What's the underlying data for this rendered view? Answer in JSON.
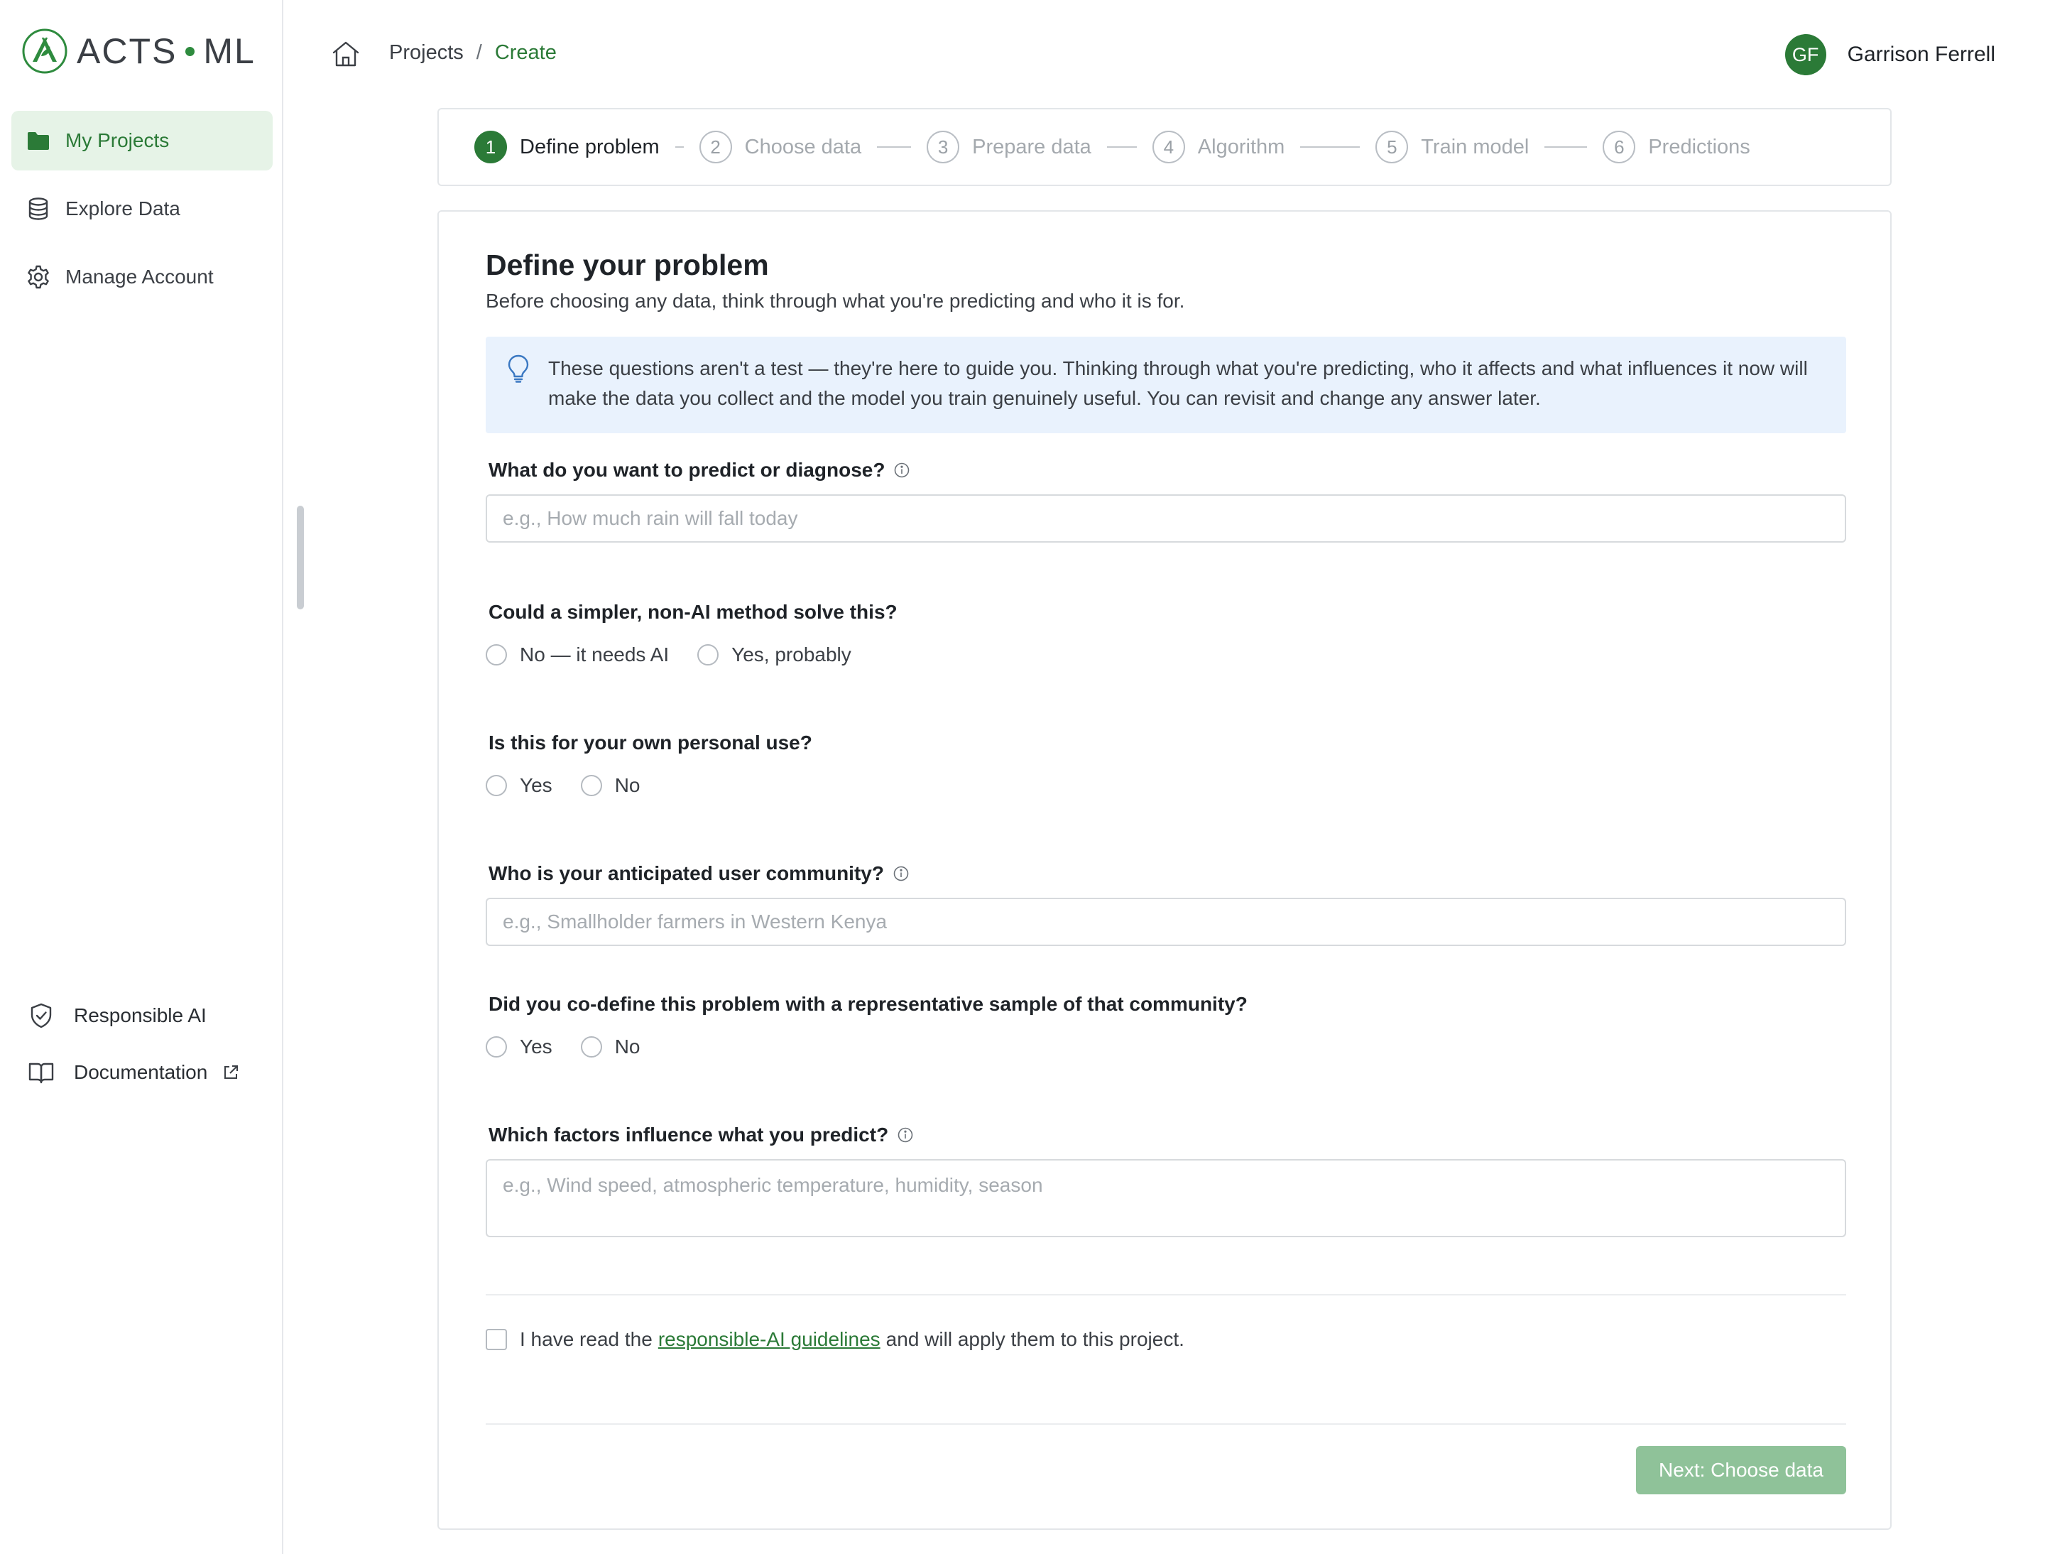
{
  "app": {
    "logo_left": "ACTS",
    "logo_right": "ML"
  },
  "sidebar": {
    "items": [
      {
        "label": "My Projects",
        "icon": "folder-icon",
        "active": true
      },
      {
        "label": "Explore Data",
        "icon": "database-icon",
        "active": false
      },
      {
        "label": "Manage Account",
        "icon": "gear-icon",
        "active": false
      }
    ],
    "bottom": [
      {
        "label": "Responsible AI",
        "icon": "shield-check-icon"
      },
      {
        "label": "Documentation",
        "icon": "book-icon",
        "external": true
      }
    ]
  },
  "header": {
    "breadcrumb": {
      "projects": "Projects",
      "separator": "/",
      "current": "Create"
    },
    "user": {
      "initials": "GF",
      "name": "Garrison Ferrell"
    }
  },
  "stepper": {
    "steps": [
      {
        "num": "1",
        "label": "Define problem",
        "active": true
      },
      {
        "num": "2",
        "label": "Choose data",
        "active": false
      },
      {
        "num": "3",
        "label": "Prepare data",
        "active": false
      },
      {
        "num": "4",
        "label": "Algorithm",
        "active": false
      },
      {
        "num": "5",
        "label": "Train model",
        "active": false
      },
      {
        "num": "6",
        "label": "Predictions",
        "active": false
      }
    ]
  },
  "form": {
    "title": "Define your problem",
    "subtitle": "Before choosing any data, think through what you're predicting and who it is for.",
    "info": "These questions aren't a test — they're here to guide you. Thinking through what you're predicting, who it affects and what influences it now will make the data you collect and the model you train genuinely useful. You can revisit and change any answer later.",
    "q1": {
      "label": "What do you want to predict or diagnose?",
      "placeholder": "e.g., How much rain will fall today",
      "value": ""
    },
    "q2": {
      "label": "Could a simpler, non-AI method solve this?",
      "options": [
        "No — it needs AI",
        "Yes, probably"
      ],
      "selected": null
    },
    "q3": {
      "label": "Is this for your own personal use?",
      "options": [
        "Yes",
        "No"
      ],
      "selected": null
    },
    "q4": {
      "label": "Who is your anticipated user community?",
      "placeholder": "e.g., Smallholder farmers in Western Kenya",
      "value": ""
    },
    "q5": {
      "label": "Did you co-define this problem with a representative sample of that community?",
      "options": [
        "Yes",
        "No"
      ],
      "selected": null
    },
    "q6": {
      "label": "Which factors influence what you predict?",
      "placeholder": "e.g., Wind speed, atmospheric temperature, humidity, season",
      "value": ""
    },
    "agreement": {
      "before": "I have read the",
      "link": "responsible-AI guidelines",
      "after": "and will apply them to this project.",
      "checked": false
    },
    "next_button": "Next: Choose data"
  },
  "colors": {
    "accent": "#2b7a37",
    "accent_light": "#e6f3e7",
    "info_bg": "#e9f2fd",
    "button_disabled": "#8fc299"
  }
}
